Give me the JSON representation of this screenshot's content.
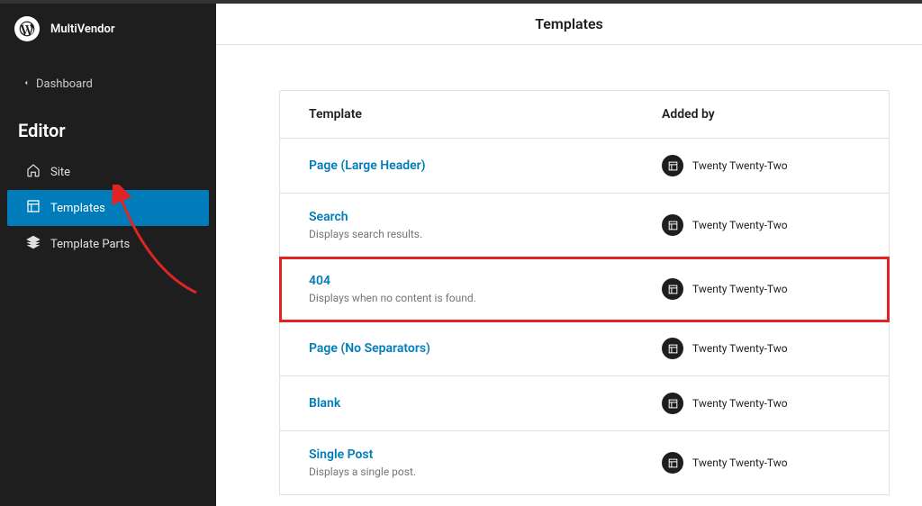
{
  "sidebar": {
    "site_name": "MultiVendor",
    "back_label": "Dashboard",
    "section_title": "Editor",
    "items": [
      {
        "label": "Site"
      },
      {
        "label": "Templates"
      },
      {
        "label": "Template Parts"
      }
    ]
  },
  "page": {
    "title": "Templates"
  },
  "table": {
    "head_template": "Template",
    "head_added_by": "Added by",
    "rows": [
      {
        "name": "Page (Large Header)",
        "desc": "",
        "added_by": "Twenty Twenty-Two"
      },
      {
        "name": "Search",
        "desc": "Displays search results.",
        "added_by": "Twenty Twenty-Two"
      },
      {
        "name": "404",
        "desc": "Displays when no content is found.",
        "added_by": "Twenty Twenty-Two"
      },
      {
        "name": "Page (No Separators)",
        "desc": "",
        "added_by": "Twenty Twenty-Two"
      },
      {
        "name": "Blank",
        "desc": "",
        "added_by": "Twenty Twenty-Two"
      },
      {
        "name": "Single Post",
        "desc": "Displays a single post.",
        "added_by": "Twenty Twenty-Two"
      }
    ]
  }
}
